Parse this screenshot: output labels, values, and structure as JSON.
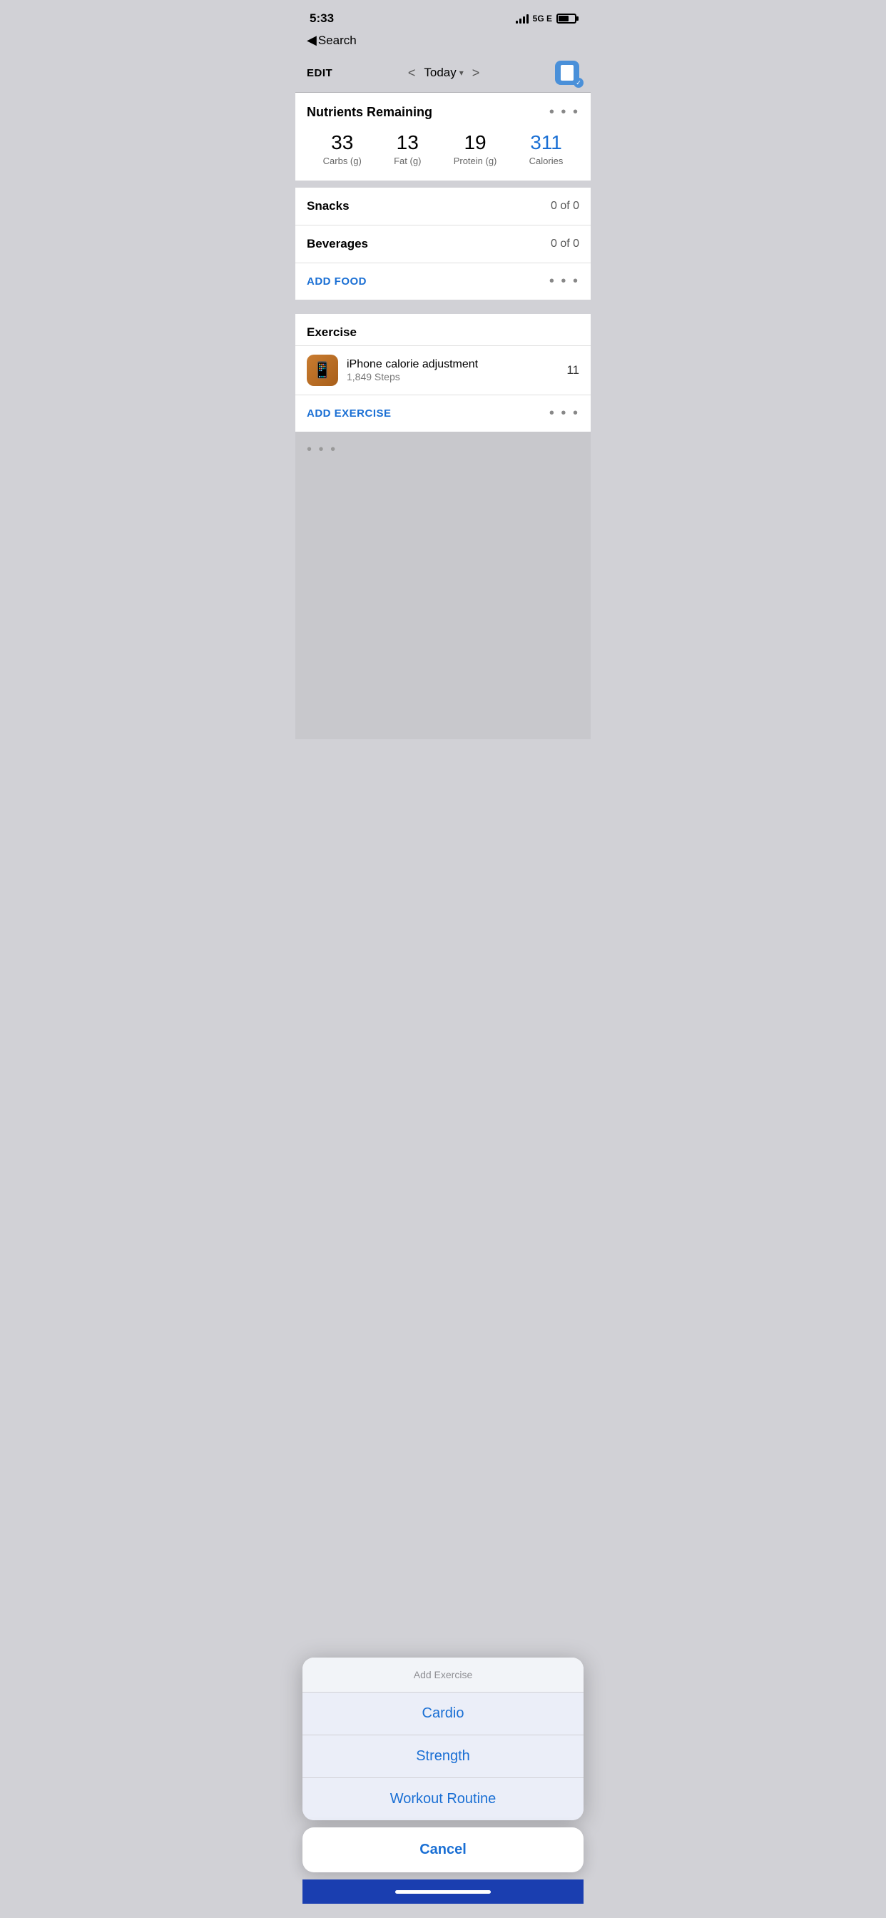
{
  "statusBar": {
    "time": "5:33",
    "network": "5G E",
    "batteryPercent": 65
  },
  "backNav": {
    "arrow": "◀",
    "label": "Search"
  },
  "toolbar": {
    "editLabel": "EDIT",
    "dateLabel": "Today",
    "prevArrow": "<",
    "nextArrow": ">",
    "checkmark": "✓"
  },
  "nutrients": {
    "title": "Nutrients Remaining",
    "moreIcon": "• • •",
    "items": [
      {
        "value": "33",
        "label": "Carbs (g)",
        "isBlue": false
      },
      {
        "value": "13",
        "label": "Fat (g)",
        "isBlue": false
      },
      {
        "value": "19",
        "label": "Protein (g)",
        "isBlue": false
      },
      {
        "value": "311",
        "label": "Calories",
        "isBlue": true
      }
    ]
  },
  "snacks": {
    "title": "Snacks",
    "value": "0 of 0"
  },
  "beverages": {
    "title": "Beverages",
    "value": "0 of 0"
  },
  "addFood": {
    "label": "ADD FOOD",
    "moreIcon": "• • •"
  },
  "exercise": {
    "title": "Exercise",
    "entry": {
      "name": "iPhone calorie adjustment",
      "detail": "1,849 Steps",
      "calories": "11"
    },
    "addLabel": "ADD EXERCISE",
    "moreIcon": "• • •"
  },
  "actionSheet": {
    "title": "Add Exercise",
    "items": [
      {
        "label": "Cardio"
      },
      {
        "label": "Strength"
      },
      {
        "label": "Workout Routine"
      }
    ],
    "cancelLabel": "Cancel"
  }
}
